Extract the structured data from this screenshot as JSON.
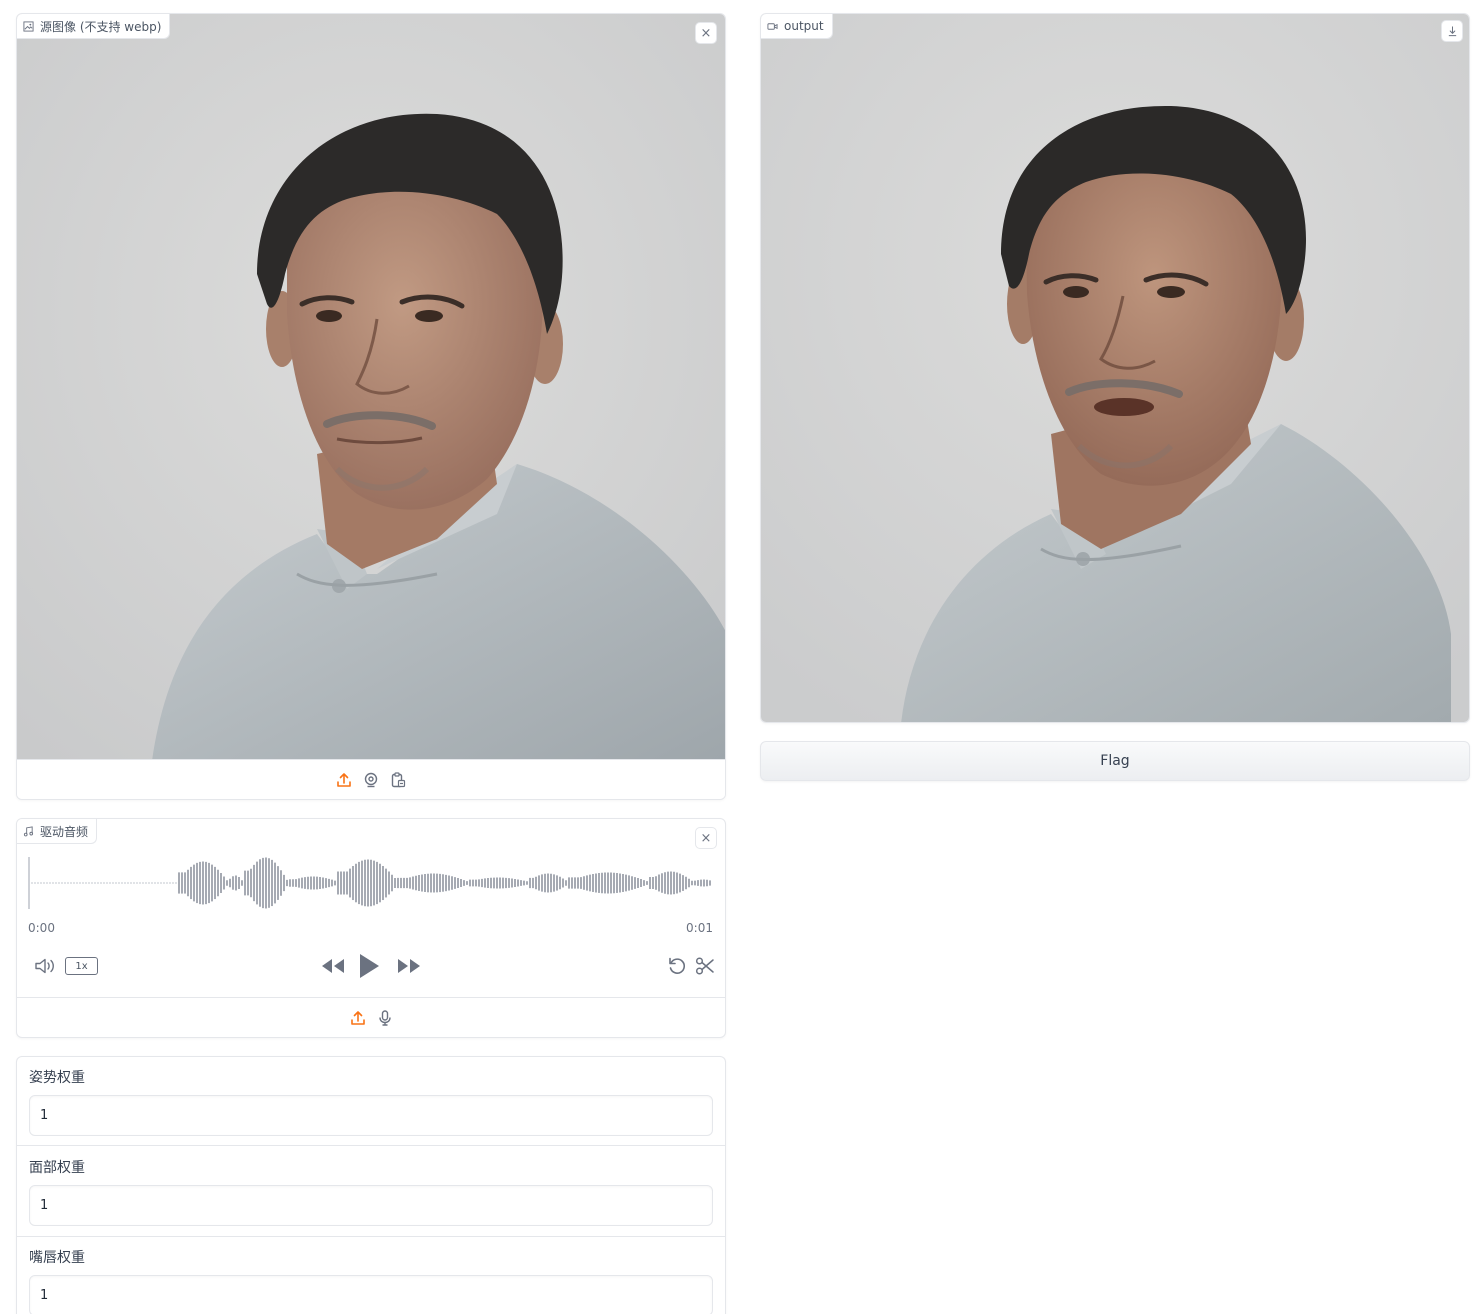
{
  "source_image": {
    "label": "源图像 (不支持 webp)",
    "clear_symbol": "×",
    "toolbar_icons": [
      "upload-icon",
      "webcam-icon",
      "clipboard-icon"
    ]
  },
  "audio": {
    "label": "驱动音频",
    "clear_symbol": "×",
    "time_start": "0:00",
    "time_end": "0:01",
    "playback_rate": "1x",
    "toolbar_icons": [
      "upload-icon",
      "microphone-icon"
    ]
  },
  "weights": [
    {
      "label": "姿势权重",
      "value": "1"
    },
    {
      "label": "面部权重",
      "value": "1"
    },
    {
      "label": "嘴唇权重",
      "value": "1"
    }
  ],
  "output": {
    "label": "output",
    "icon": "video-icon",
    "download_icon": "download-icon"
  },
  "flag_button": {
    "label": "Flag"
  },
  "colors": {
    "accent": "#f97316",
    "border": "#e5e7eb",
    "text": "#374151",
    "muted": "#6b7280",
    "backdrop": "#d3d4d4",
    "shirt": "#b3babe"
  }
}
